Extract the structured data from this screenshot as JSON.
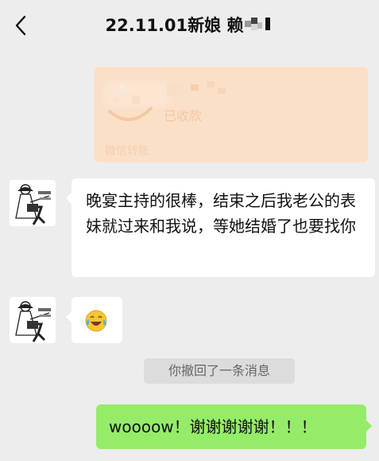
{
  "header": {
    "title": "22.11.01新娘 赖",
    "back_icon": "chevron-left-icon"
  },
  "transfer": {
    "status": "已收款",
    "label": "微信转账",
    "icon": "check-circle-icon",
    "colors": {
      "card": "#fbe0c8"
    }
  },
  "messages": [
    {
      "sender": "other",
      "type": "text",
      "text": "晚宴主持的很棒，结束之后我老公的表妹就过来和我说，等她结婚了也要找你"
    },
    {
      "sender": "other",
      "type": "emoji",
      "emoji": "😂"
    }
  ],
  "system_notice": {
    "text": "你撤回了一条消息"
  },
  "my_message": {
    "text": "woooow！谢谢谢谢谢！！！",
    "color": "#95ec69"
  }
}
